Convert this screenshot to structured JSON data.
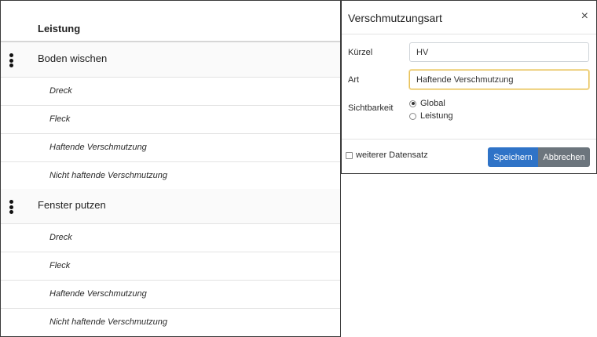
{
  "table": {
    "header": "Leistung",
    "groups": [
      {
        "label": "Boden wischen",
        "items": [
          "Dreck",
          "Fleck",
          "Haftende Verschmutzung",
          "Nicht haftende Verschmutzung"
        ]
      },
      {
        "label": "Fenster putzen",
        "items": [
          "Dreck",
          "Fleck",
          "Haftende Verschmutzung",
          "Nicht haftende Verschmutzung"
        ]
      }
    ]
  },
  "modal": {
    "title": "Verschmutzungsart",
    "close_glyph": "×",
    "kuerzel": {
      "label": "Kürzel",
      "value": "HV"
    },
    "art": {
      "label": "Art",
      "value": "Haftende Verschmutzung"
    },
    "sichtbarkeit": {
      "label": "Sichtbarkeit",
      "options": [
        {
          "label": "Global",
          "checked": true
        },
        {
          "label": "Leistung",
          "checked": false
        }
      ]
    },
    "weiterer_datensatz": {
      "label": "weiterer Datensatz",
      "checked": false
    },
    "buttons": {
      "save": "Speichern",
      "cancel": "Abbrechen"
    }
  },
  "colors": {
    "primary": "#2f73c7",
    "secondary": "#6c757d",
    "focus_border": "#e8c15a"
  }
}
